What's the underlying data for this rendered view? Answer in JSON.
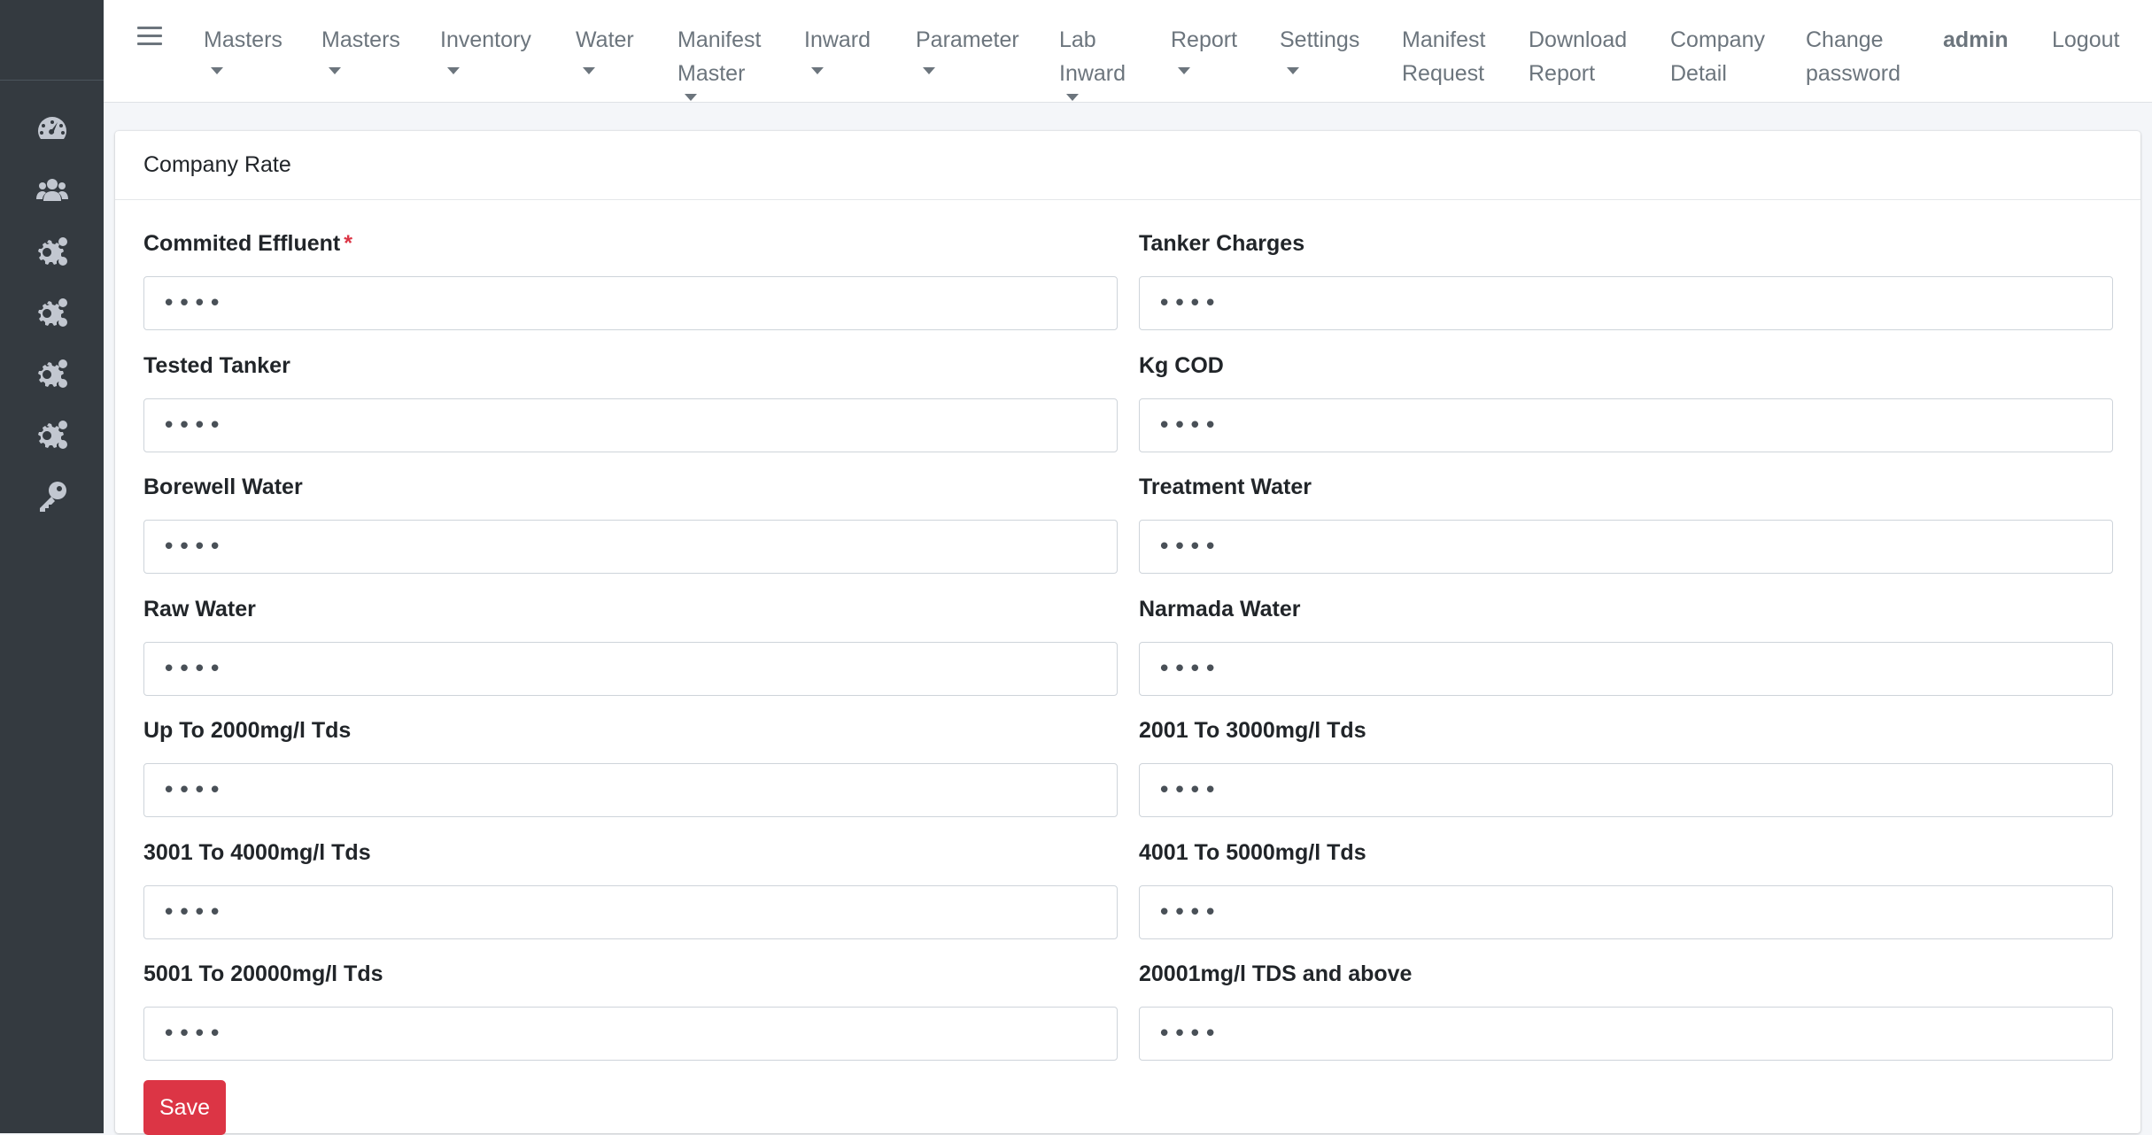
{
  "sidebar": {
    "icons": [
      "dashboard-icon",
      "users-icon",
      "gears-icon",
      "gears-icon",
      "gears-icon",
      "gears-icon",
      "key-icon"
    ]
  },
  "topnav": {
    "items": [
      {
        "line1": "Masters",
        "line2": ""
      },
      {
        "line1": "Masters",
        "line2": ""
      },
      {
        "line1": "Inventory",
        "line2": ""
      },
      {
        "line1": "Water",
        "line2": ""
      },
      {
        "line1": "Manifest",
        "line2": "Master"
      },
      {
        "line1": "Inward",
        "line2": ""
      },
      {
        "line1": "Parameter",
        "line2": ""
      },
      {
        "line1": "Lab",
        "line2": "Inward"
      },
      {
        "line1": "Report",
        "line2": ""
      },
      {
        "line1": "Settings",
        "line2": ""
      },
      {
        "line1": "Manifest",
        "line2": "Request"
      },
      {
        "line1": "Download",
        "line2": "Report"
      },
      {
        "line1": "Company",
        "line2": "Detail"
      },
      {
        "line1": "Change",
        "line2": "password"
      },
      {
        "line1": "admin",
        "line2": ""
      },
      {
        "line1": "Logout",
        "line2": ""
      }
    ]
  },
  "card": {
    "title": "Company Rate",
    "fields": [
      {
        "label": "Commited Effluent",
        "required": "*",
        "value": "••••"
      },
      {
        "label": "Tanker Charges",
        "value": "••••"
      },
      {
        "label": "Tested Tanker",
        "value": "••••"
      },
      {
        "label": "Kg COD",
        "value": "••••"
      },
      {
        "label": "Borewell Water",
        "value": "••••"
      },
      {
        "label": "Treatment Water",
        "value": "••••"
      },
      {
        "label": "Raw Water",
        "value": "••••"
      },
      {
        "label": "Narmada Water",
        "value": "••••"
      },
      {
        "label": "Up To 2000mg/l Tds",
        "value": "••••"
      },
      {
        "label": "2001 To 3000mg/l Tds",
        "value": "••••"
      },
      {
        "label": "3001 To 4000mg/l Tds",
        "value": "••••"
      },
      {
        "label": "4001 To 5000mg/l Tds",
        "value": "••••"
      },
      {
        "label": "5001 To 20000mg/l Tds",
        "value": "••••"
      },
      {
        "label": "20001mg/l TDS and above",
        "value": "••••"
      }
    ],
    "save_label": "Save"
  },
  "colors": {
    "sidebar_bg": "#343a40",
    "accent_required": "#dc3545",
    "save_button": "#dc3545"
  }
}
